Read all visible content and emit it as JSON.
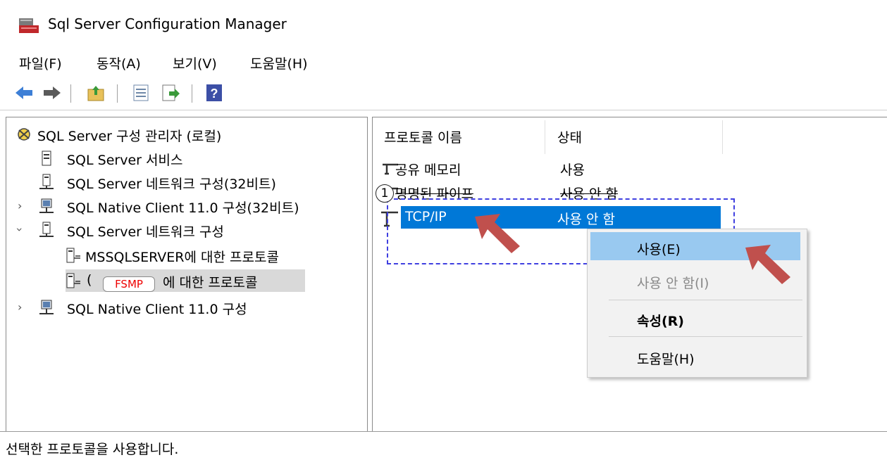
{
  "window": {
    "title": "Sql Server Configuration Manager"
  },
  "menu": {
    "items": [
      "파일(F)",
      "동작(A)",
      "보기(V)",
      "도움말(H)"
    ]
  },
  "toolbar": {
    "buttons": [
      "back-icon",
      "forward-icon",
      "up-folder-icon",
      "properties-icon",
      "export-icon",
      "help-icon"
    ]
  },
  "tree": {
    "root": "SQL Server 구성 관리자 (로컬)",
    "services": "SQL Server 서비스",
    "network32": "SQL Server 네트워크 구성(32비트)",
    "native32": "SQL Native Client 11.0 구성(32비트)",
    "network": "SQL Server 네트워크 구성",
    "mssql_protocols": "MSSQLSERVER에 대한 프로토콜",
    "fsmp_prefix": "(",
    "fsmp_suffix": "에 대한 프로토콜",
    "native": "SQL Native Client 11.0 구성"
  },
  "annotation": {
    "redact_label": "FSMP",
    "step": "1"
  },
  "protocols": {
    "headers": {
      "name": "프로토콜 이름",
      "state": "상태"
    },
    "rows": [
      {
        "name": "공유 메모리",
        "state": "사용"
      },
      {
        "name": "명명된 파이프",
        "state": "사용 안 함"
      },
      {
        "name": "TCP/IP",
        "state": "사용 안 함"
      }
    ]
  },
  "context_menu": {
    "enable": "사용(E)",
    "disable": "사용 안 함(I)",
    "properties": "속성(R)",
    "help": "도움말(H)"
  },
  "status": {
    "text": "선택한 프로토콜을 사용합니다."
  },
  "colors": {
    "selection": "#0078d7",
    "arrow": "#c0504d",
    "dashed_box": "#3f3fe0",
    "redact_text": "#e00000"
  }
}
